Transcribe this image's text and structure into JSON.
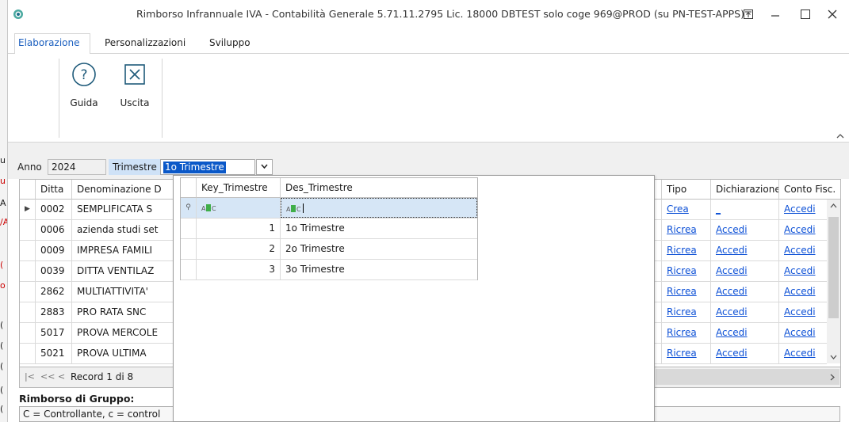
{
  "window": {
    "title": "Rimborso Infrannuale IVA - Contabilità Generale 5.71.11.2795 Lic. 18000 DBTEST solo coge 969@PROD (su PN-TEST-APPS)"
  },
  "left_strip_fragments": [
    "u",
    "u",
    "A",
    "/A",
    "(",
    "o",
    "(",
    "(",
    "(",
    "(",
    "("
  ],
  "ribbon": {
    "tabs": [
      "Elaborazione",
      "Personalizzazioni",
      "Sviluppo"
    ],
    "buttons": {
      "guida": "Guida",
      "uscita": "Uscita"
    }
  },
  "filters": {
    "anno_label": "Anno",
    "anno_value": "2024",
    "trimestre_label": "Trimestre",
    "trimestre_value": "1o Trimestre"
  },
  "grid": {
    "columns": [
      "Ditta",
      "Denominazione D",
      "Tipo",
      "Dichiarazione",
      "Conto Fisc."
    ],
    "rows": [
      {
        "ditta": "0002",
        "denominazione": "SEMPLIFICATA S",
        "tipo": "Crea",
        "dichiarazione": "_",
        "conto": "Accedi"
      },
      {
        "ditta": "0006",
        "denominazione": "azienda studi set",
        "tipo": "Ricrea",
        "dichiarazione": "Accedi",
        "conto": "Accedi"
      },
      {
        "ditta": "0009",
        "denominazione": "IMPRESA FAMILI",
        "tipo": "Ricrea",
        "dichiarazione": "Accedi",
        "conto": "Accedi"
      },
      {
        "ditta": "0039",
        "denominazione": "DITTA VENTILAZ",
        "tipo": "Ricrea",
        "dichiarazione": "Accedi",
        "conto": "Accedi"
      },
      {
        "ditta": "2862",
        "denominazione": "MULTIATTIVITA'",
        "tipo": "Ricrea",
        "dichiarazione": "Accedi",
        "conto": "Accedi"
      },
      {
        "ditta": "2883",
        "denominazione": "PRO RATA SNC",
        "tipo": "Ricrea",
        "dichiarazione": "Accedi",
        "conto": "Accedi"
      },
      {
        "ditta": "5017",
        "denominazione": "PROVA MERCOLE",
        "tipo": "Ricrea",
        "dichiarazione": "Accedi",
        "conto": "Accedi"
      },
      {
        "ditta": "5021",
        "denominazione": "PROVA ULTIMA",
        "tipo": "Ricrea",
        "dichiarazione": "Accedi",
        "conto": "Accedi"
      }
    ],
    "record_text": "Record 1 di 8"
  },
  "dropdown": {
    "columns": [
      "Key_Trimestre",
      "Des_Trimestre"
    ],
    "rows": [
      {
        "key": "1",
        "des": "1o Trimestre"
      },
      {
        "key": "2",
        "des": "2o Trimestre"
      },
      {
        "key": "3",
        "des": "3o Trimestre"
      }
    ]
  },
  "group": {
    "label": "Rimborso di Gruppo:",
    "legend": "C = Controllante, c = control"
  },
  "colors": {
    "accent_blue": "#0a58c8",
    "link": "#0b4fd6",
    "selection": "#cfe2f7"
  }
}
